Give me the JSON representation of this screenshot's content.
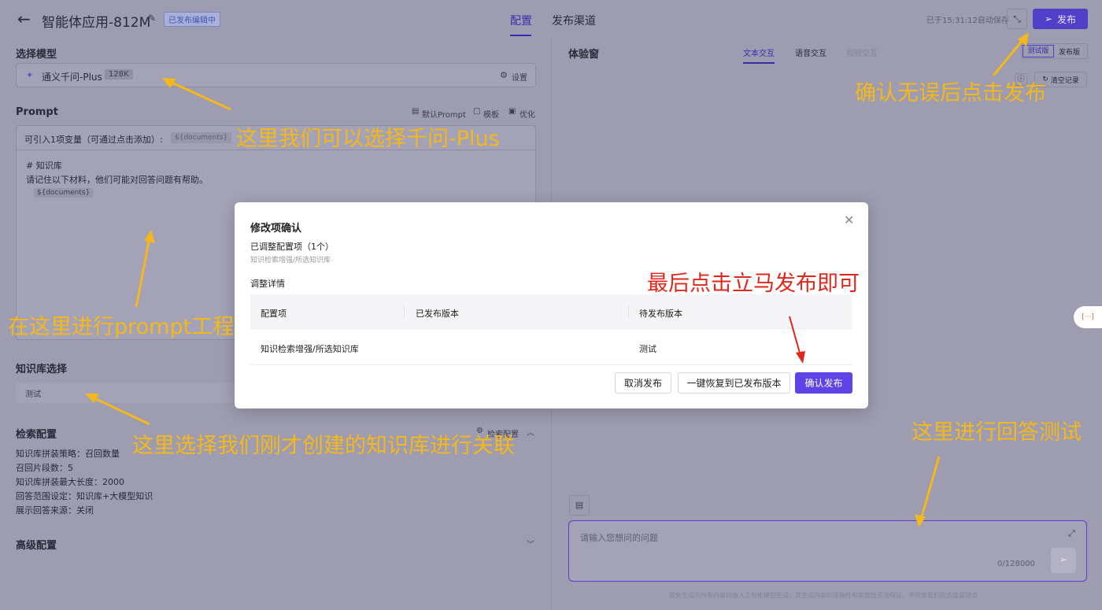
{
  "header": {
    "back_icon": "arrow-left-icon",
    "title": "智能体应用-812M",
    "edit_icon": "edit-icon",
    "status_badge": "已发布编辑中",
    "tab_config": "配置",
    "tab_channel": "发布渠道",
    "autosave": "已于15:31:12自动保存",
    "publish": "发布"
  },
  "left": {
    "model_section": "选择模型",
    "model_name": "通义千问-Plus",
    "model_ctx": "128K",
    "model_settings": "设置",
    "prompt_section": "Prompt",
    "prompt_default": "默认Prompt",
    "prompt_template": "模板",
    "prompt_optimize": "优化",
    "var_hint": "可引入1项变量（可通过点击添加）:",
    "var_tag": "${documents}",
    "prompt_line1": "# 知识库",
    "prompt_line2": "请记住以下材料，他们可能对回答问题有帮助。",
    "prompt_line3": "${documents}",
    "kb_section": "知识库选择",
    "kb_item": "测试",
    "retrieval_section": "检索配置",
    "retrieval_settings": "检索配置",
    "retrieval_lines": [
      "知识库拼装策略：召回数量",
      "召回片段数：5",
      "知识库拼装最大长度：2000",
      "回答范围设定：知识库+大模型知识",
      "展示回答来源：关闭"
    ],
    "advanced_section": "高级配置"
  },
  "right": {
    "title": "体验窗",
    "tab_text": "文本交互",
    "tab_voice": "语音交互",
    "tab_video": "视频交互",
    "ver_test": "测试版",
    "ver_pub": "发布版",
    "clear": "清空记录",
    "input_placeholder": "请输入您想问的问题",
    "counter": "0/128000",
    "footer": "服务生成的所有内容均由人工智能模型生成，其生成内容的准确性和完整性无法保证，不代表我们的态度或观点"
  },
  "float_btn": "[···]",
  "modal": {
    "title": "修改项确认",
    "adjusted": "已调整配置项（1个）",
    "adjusted_sub": "知识检索增强/所选知识库",
    "details": "调整详情",
    "col1": "配置项",
    "col2": "已发布版本",
    "col3": "待发布版本",
    "row_item": "知识检索增强/所选知识库",
    "row_published": "",
    "row_pending": "测试",
    "btn_cancel": "取消发布",
    "btn_restore": "一键恢复到已发布版本",
    "btn_confirm": "确认发布"
  },
  "annotations": {
    "model": "这里我们可以选择千问-Plus",
    "prompt": "在这里进行prompt工程",
    "kb": "这里选择我们刚才创建的知识库进行关联",
    "publish": "确认无误后点击发布",
    "confirm": "最后点击立马发布即可",
    "test": "这里进行回答测试"
  },
  "colors": {
    "accent": "#5e43e6",
    "annotation": "#f5b81a",
    "annotation_red": "#e0271c"
  }
}
